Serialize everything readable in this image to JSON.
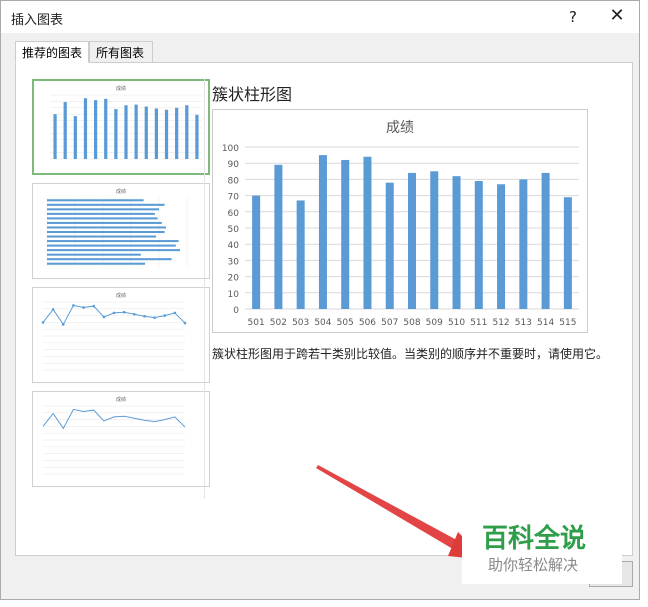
{
  "dialog": {
    "title": "插入图表",
    "help_label": "?",
    "close_label": "✕",
    "tabs": [
      {
        "label": "推荐的图表",
        "active": true
      },
      {
        "label": "所有图表",
        "active": false
      }
    ]
  },
  "selected_chart": {
    "type_name": "簇状柱形图",
    "description": "簇状柱形图用于跨若干类别比较值。当类别的顺序并不重要时，请使用它。"
  },
  "chart_data": {
    "type": "bar",
    "title": "成绩",
    "categories": [
      "501",
      "502",
      "503",
      "504",
      "505",
      "506",
      "507",
      "508",
      "509",
      "510",
      "511",
      "512",
      "513",
      "514",
      "515"
    ],
    "values": [
      70,
      89,
      67,
      95,
      92,
      94,
      78,
      84,
      85,
      82,
      79,
      77,
      80,
      84,
      69
    ],
    "ylim": [
      0,
      100
    ],
    "yticks": [
      "0",
      "10",
      "20",
      "30",
      "40",
      "50",
      "60",
      "70",
      "80",
      "90",
      "100"
    ],
    "grid": true,
    "bar_color": "#5b9bd5"
  },
  "thumbnails": [
    {
      "kind": "clustered-column",
      "title": "成绩",
      "selected": true
    },
    {
      "kind": "clustered-bar",
      "title": "成绩",
      "selected": false
    },
    {
      "kind": "line-with-markers",
      "title": "成绩",
      "selected": false
    },
    {
      "kind": "line",
      "title": "成绩",
      "selected": false
    }
  ],
  "watermark": {
    "title": "百科全说",
    "subtitle": "助你轻松解决",
    "color": "#2e9e4a"
  },
  "colors": {
    "accent": "#5b9bd5",
    "selection": "#7aba7a",
    "arrow": "#e03b3b"
  }
}
